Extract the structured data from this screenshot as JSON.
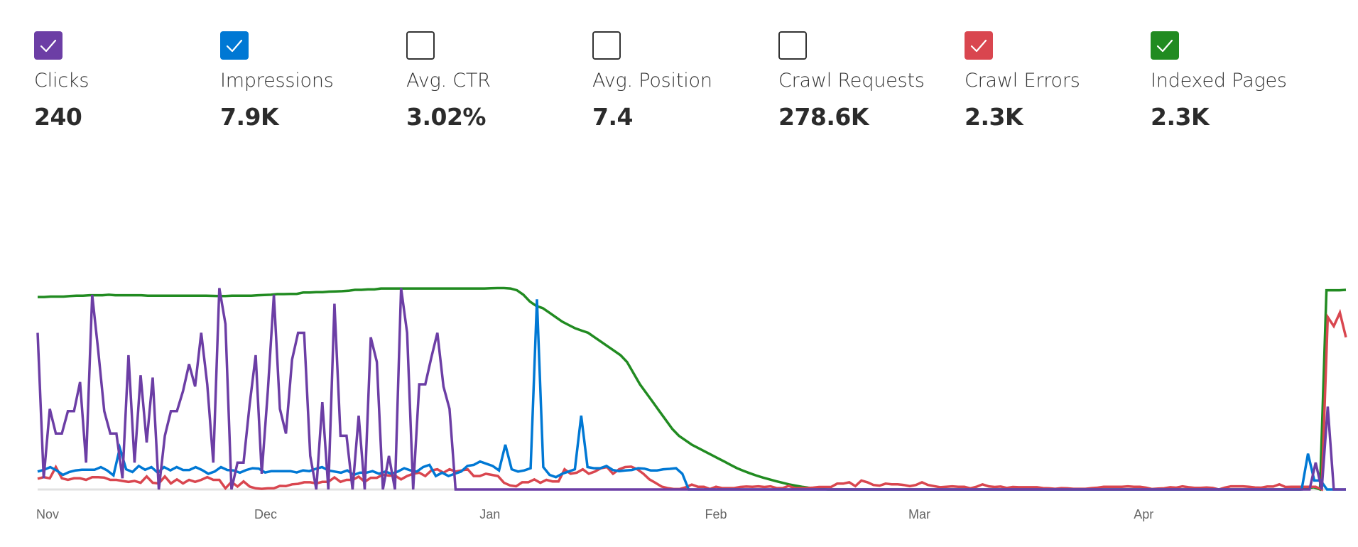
{
  "metrics": [
    {
      "id": "clicks",
      "label": "Clicks",
      "value": "240",
      "checked": true,
      "color": "#6c3ea5"
    },
    {
      "id": "impressions",
      "label": "Impressions",
      "value": "7.9K",
      "checked": true,
      "color": "#0078d4"
    },
    {
      "id": "avg-ctr",
      "label": "Avg. CTR",
      "value": "3.02%",
      "checked": false,
      "color": "#333333"
    },
    {
      "id": "avg-position",
      "label": "Avg. Position",
      "value": "7.4",
      "checked": false,
      "color": "#333333"
    },
    {
      "id": "crawl-requests",
      "label": "Crawl Requests",
      "value": "278.6K",
      "checked": false,
      "color": "#333333"
    },
    {
      "id": "crawl-errors",
      "label": "Crawl Errors",
      "value": "2.3K",
      "checked": true,
      "color": "#d9464f"
    },
    {
      "id": "indexed-pages",
      "label": "Indexed Pages",
      "value": "2.3K",
      "checked": true,
      "color": "#218b21"
    }
  ],
  "chart_data": {
    "type": "line",
    "title": "",
    "xlabel": "",
    "ylabel": "",
    "x_ticks": [
      "Nov",
      "Dec",
      "Jan",
      "Feb",
      "Mar",
      "Apr"
    ],
    "x_tick_positions_days": [
      0,
      30,
      61,
      92,
      120,
      151
    ],
    "x_range_days": [
      0,
      180
    ],
    "y_units": "percent of each series' own max (independent normalized axes)",
    "ylim": [
      0,
      100
    ],
    "grid": false,
    "legend": "top (metric checkboxes)",
    "series": [
      {
        "name": "Indexed Pages",
        "color": "#218b21",
        "values": [
          86,
          86,
          86.2,
          86.2,
          86.2,
          86.4,
          86.6,
          86.6,
          86.8,
          86.8,
          86.8,
          87,
          86.8,
          86.8,
          86.8,
          86.8,
          86.8,
          86.6,
          86.6,
          86.6,
          86.6,
          86.6,
          86.6,
          86.6,
          86.6,
          86.6,
          86.6,
          86.5,
          86.4,
          86.4,
          86.6,
          86.6,
          86.6,
          86.6,
          86.8,
          86.9,
          87,
          87.3,
          87.3,
          87.4,
          87.4,
          88,
          88,
          88.2,
          88.2,
          88.4,
          88.5,
          88.6,
          88.8,
          89.2,
          89.2,
          89.4,
          89.4,
          89.8,
          89.8,
          89.8,
          89.8,
          89.8,
          89.8,
          89.8,
          89.8,
          89.8,
          89.8,
          89.8,
          89.8,
          89.8,
          89.8,
          89.8,
          89.8,
          89.8,
          89.9,
          90,
          90,
          89.8,
          89,
          87,
          84,
          82,
          81,
          79,
          77,
          75,
          73.5,
          72,
          71,
          70,
          68,
          66,
          64,
          62,
          60,
          57,
          52,
          47,
          43,
          39,
          35,
          31,
          27,
          24,
          22,
          20,
          18.5,
          17,
          15.5,
          14,
          12.5,
          11,
          9.5,
          8.3,
          7.2,
          6.2,
          5.3,
          4.5,
          3.7,
          3,
          2.3,
          1.7,
          1.2,
          0.8,
          0.5,
          0.2,
          0,
          0,
          0,
          0,
          0,
          0,
          0,
          0,
          0,
          0,
          0,
          0,
          0,
          0,
          0,
          0,
          0,
          0,
          0,
          0,
          0,
          0,
          0,
          0,
          0,
          0,
          0,
          0,
          0,
          0,
          0,
          0,
          0,
          0,
          0,
          0,
          0,
          0,
          0,
          0,
          0,
          0,
          0,
          0,
          0,
          0,
          0,
          0,
          0,
          0,
          0,
          0,
          0,
          0,
          0,
          0,
          0,
          0,
          0,
          0,
          0,
          0,
          0,
          0,
          0,
          0,
          0,
          0,
          0,
          0,
          0,
          0,
          0,
          0,
          0.5,
          1,
          0,
          89,
          89,
          89,
          89.2
        ]
      },
      {
        "name": "Crawl Errors",
        "color": "#d9464f",
        "values": [
          4.8,
          5.5,
          5,
          10,
          5,
          4.3,
          5,
          5,
          4.3,
          5.5,
          5.5,
          5.3,
          4.3,
          4.3,
          3.8,
          3.4,
          3.8,
          3,
          5.8,
          3,
          2.7,
          5.8,
          2.7,
          4.5,
          2.7,
          4.3,
          3.4,
          4.3,
          5.5,
          4.3,
          4.3,
          0.5,
          3.4,
          1.3,
          3.6,
          1.3,
          0.5,
          0.3,
          0.5,
          0.5,
          1.6,
          1.5,
          2.3,
          2.5,
          3.2,
          3.2,
          2.7,
          3.4,
          3.4,
          5.4,
          3.4,
          4.3,
          4.3,
          5.7,
          3.4,
          5.2,
          5.2,
          6.6,
          6.2,
          6.2,
          4.5,
          6,
          7,
          7.5,
          6,
          8.5,
          9,
          7.5,
          9,
          8,
          8.5,
          9,
          6,
          6,
          7,
          6.5,
          6,
          3,
          1.8,
          1.4,
          3.2,
          3.2,
          4.5,
          3,
          4.3,
          3.6,
          3.6,
          9,
          7,
          7.5,
          9,
          7,
          8,
          9.5,
          10,
          7,
          9,
          10,
          10.2,
          9,
          7,
          4.5,
          3,
          1.3,
          0.6,
          0.2,
          0.2,
          1,
          2.2,
          1.2,
          1.2,
          0.2,
          1.2,
          0.6,
          0.6,
          0.6,
          1.1,
          1.3,
          1.2,
          1.4,
          1.1,
          1.4,
          0.6,
          0.6,
          1.6,
          0.6,
          0.6,
          0.6,
          0.8,
          1.1,
          1.1,
          1.1,
          2.6,
          2.6,
          3.2,
          1.5,
          4,
          3.2,
          2,
          1.7,
          2.6,
          2.3,
          2.3,
          2,
          1.5,
          2,
          3.2,
          2,
          1.5,
          1,
          1.2,
          1.4,
          1.2,
          1.2,
          0.5,
          1.2,
          2.3,
          1.4,
          1.1,
          1.3,
          0.7,
          1.1,
          1,
          1,
          1,
          1,
          0.6,
          0.5,
          0.3,
          0.6,
          0.5,
          0.3,
          0.3,
          0.3,
          0.6,
          0.8,
          1.2,
          1.2,
          1.2,
          1.2,
          1.4,
          1.2,
          1.2,
          0.8,
          0.2,
          0.4,
          0.5,
          1,
          0.8,
          1.4,
          1,
          0.7,
          0.7,
          0.9,
          0.7,
          0,
          0.8,
          1.4,
          1.4,
          1.4,
          1.2,
          0.9,
          0.8,
          1.3,
          1.3,
          2.3,
          1.1,
          1.2,
          1.2,
          1.2,
          1.2,
          1.2,
          0,
          77,
          73,
          79,
          68
        ]
      },
      {
        "name": "Impressions",
        "color": "#0078d4",
        "values": [
          8,
          8.8,
          10,
          8.5,
          6.5,
          7.8,
          8.5,
          8.8,
          8.8,
          8.8,
          10,
          8.5,
          6.3,
          18.5,
          9,
          7.8,
          10.5,
          8.8,
          10,
          7.5,
          10,
          8.5,
          10,
          8.7,
          8.7,
          10,
          8.7,
          7,
          8,
          10,
          8.7,
          8.5,
          7.5,
          8.7,
          9.5,
          9.3,
          7.6,
          8.2,
          8.2,
          8.2,
          8.2,
          7.6,
          8.5,
          8.2,
          9.2,
          10,
          8.5,
          8,
          7.5,
          8.5,
          6.5,
          7.5,
          7.5,
          8.2,
          7,
          8,
          7,
          8,
          9.5,
          8.5,
          8,
          10,
          11,
          6,
          7.5,
          6,
          7,
          8,
          10.5,
          11,
          12.5,
          11.5,
          10.5,
          8.5,
          20,
          9,
          8,
          8.5,
          9.5,
          85,
          10,
          6.5,
          5.5,
          7,
          8,
          9,
          33,
          10,
          9.5,
          9.5,
          10.5,
          8.7,
          8.2,
          8.5,
          8.7,
          9.5,
          9.3,
          8.5,
          8.5,
          9,
          9.2,
          9.5,
          7,
          0,
          0,
          0,
          0,
          0,
          0,
          0,
          0,
          0,
          0,
          0,
          0,
          0,
          0,
          0,
          0,
          0,
          0,
          0,
          0,
          0,
          0,
          0,
          0,
          0,
          0,
          0,
          0,
          0,
          0,
          0,
          0,
          0,
          0,
          0,
          0,
          0,
          0,
          0,
          0,
          0,
          0,
          0,
          0,
          0,
          0,
          0,
          0,
          0,
          0,
          0,
          0,
          0,
          0,
          0,
          0,
          0,
          0,
          0,
          0,
          0,
          0,
          0,
          0,
          0,
          0,
          0,
          0,
          0,
          0,
          0,
          0,
          0,
          0,
          0,
          0,
          0,
          0,
          0,
          0,
          0,
          0,
          0,
          0,
          0,
          0,
          0,
          0,
          0,
          0,
          0,
          0,
          0,
          0,
          0,
          0,
          0,
          0,
          16,
          4,
          4,
          0,
          0,
          0,
          0
        ]
      },
      {
        "name": "Clicks",
        "color": "#6c3ea5",
        "values": [
          70,
          5,
          36,
          25,
          25,
          35,
          35,
          48,
          12,
          87,
          62,
          35,
          25,
          25,
          5,
          60,
          12,
          51,
          21,
          50,
          0,
          24,
          35,
          35,
          44,
          56,
          46,
          70,
          47,
          12,
          90,
          74,
          0,
          12,
          12,
          38,
          60,
          7,
          44,
          87,
          36,
          25,
          58,
          70,
          70,
          15,
          0,
          39,
          0,
          83,
          24,
          24,
          0,
          33,
          0,
          68,
          57,
          0,
          15,
          0,
          90,
          70,
          0,
          47,
          47,
          59,
          70,
          46,
          36,
          0,
          0,
          0,
          0,
          0,
          0,
          0,
          0,
          0,
          0,
          0,
          0,
          0,
          0,
          0,
          0,
          0,
          0,
          0,
          0,
          0,
          0,
          0,
          0,
          0,
          0,
          0,
          0,
          0,
          0,
          0,
          0,
          0,
          0,
          0,
          0,
          0,
          0,
          0,
          0,
          0,
          0,
          0,
          0,
          0,
          0,
          0,
          0,
          0,
          0,
          0,
          0,
          0,
          0,
          0,
          0,
          0,
          0,
          0,
          0,
          0,
          0,
          0,
          0,
          0,
          0,
          0,
          0,
          0,
          0,
          0,
          0,
          0,
          0,
          0,
          0,
          0,
          0,
          0,
          0,
          0,
          0,
          0,
          0,
          0,
          0,
          0,
          0,
          0,
          0,
          0,
          0,
          0,
          0,
          0,
          0,
          0,
          0,
          0,
          0,
          0,
          0,
          0,
          0,
          0,
          0,
          0,
          0,
          0,
          0,
          0,
          0,
          0,
          0,
          0,
          0,
          0,
          0,
          0,
          0,
          0,
          0,
          0,
          0,
          0,
          0,
          0,
          0,
          0,
          0,
          0,
          0,
          0,
          0,
          0,
          0,
          0,
          0,
          0,
          0,
          0,
          0,
          12,
          0,
          37,
          0,
          0,
          0
        ]
      }
    ]
  }
}
